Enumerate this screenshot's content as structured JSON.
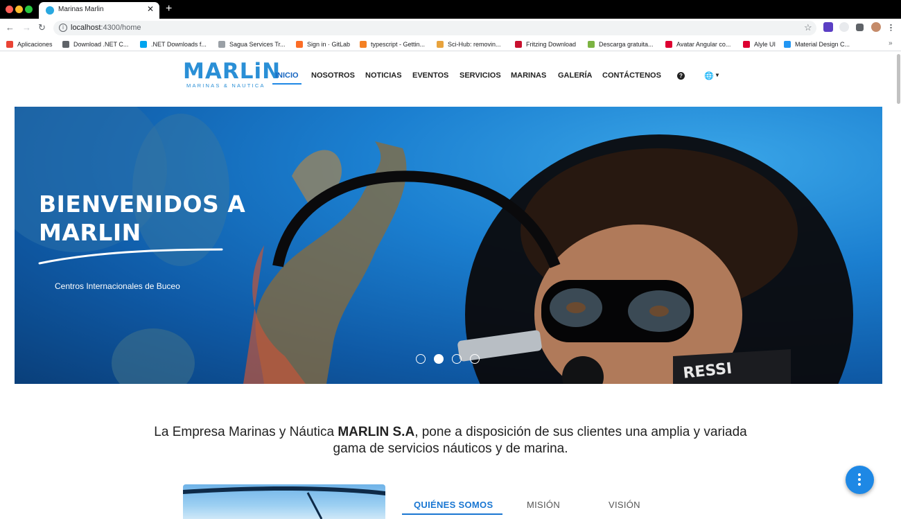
{
  "browser": {
    "tab_title": "Marinas Marlin",
    "tab_close": "✕",
    "new_tab": "+",
    "url_host": "localhost",
    "url_path": ":4300/home",
    "back": "←",
    "forward": "→",
    "reload": "↻",
    "star": "☆"
  },
  "bookmarks": [
    {
      "label": "Aplicaciones",
      "icon": "apps-grid-icon",
      "color": "#ea4335"
    },
    {
      "label": "Download .NET C...",
      "icon": "globe-icon",
      "color": "#5f6368"
    },
    {
      "label": ".NET Downloads f...",
      "icon": "windows-icon",
      "color": "#00a4ef"
    },
    {
      "label": "Sagua Services Tr...",
      "icon": "page-icon",
      "color": "#9aa0a6"
    },
    {
      "label": "Sign in · GitLab",
      "icon": "gitlab-icon",
      "color": "#fc6d26"
    },
    {
      "label": "typescript - Gettin...",
      "icon": "stackoverflow-icon",
      "color": "#f48024"
    },
    {
      "label": "Sci-Hub: removin...",
      "icon": "scihub-icon",
      "color": "#e8a33d"
    },
    {
      "label": "Fritzing Download",
      "icon": "fritzing-icon",
      "color": "#c8102e"
    },
    {
      "label": "Descarga gratuita...",
      "icon": "android-icon",
      "color": "#7cb342"
    },
    {
      "label": "Avatar Angular co...",
      "icon": "angular-icon",
      "color": "#dd0031"
    },
    {
      "label": "Alyle UI",
      "icon": "angular-icon",
      "color": "#dd0031"
    },
    {
      "label": "Material Design C...",
      "icon": "material-icon",
      "color": "#2196f3"
    }
  ],
  "bookmarks_more": "»",
  "logo": {
    "main": "MARLiN",
    "sub": "MARINAS & NAUTICA"
  },
  "nav": {
    "items": [
      "INICIO",
      "NOSOTROS",
      "NOTICIAS",
      "EVENTOS",
      "SERVICIOS",
      "MARINAS",
      "GALERÍA",
      "CONTÁCTENOS"
    ],
    "help": "?",
    "globe": "🌐",
    "caret": "▼"
  },
  "hero": {
    "title": "BIENVENIDOS A MARLIN",
    "subtitle": "Centros Internacionales de Buceo",
    "slides": 4,
    "active_slide": 1
  },
  "intro": {
    "before": "La Empresa Marinas y Náutica ",
    "bold": "MARLIN S.A",
    "after": ", pone a disposición de sus clientes una amplia y variada gama de servicios náuticos y de marina."
  },
  "tabs": [
    "QUIÉNES SOMOS",
    "MISIÓN",
    "VISIÓN"
  ],
  "colors": {
    "accent": "#1e88e5",
    "brand": "#2a8fd6"
  }
}
